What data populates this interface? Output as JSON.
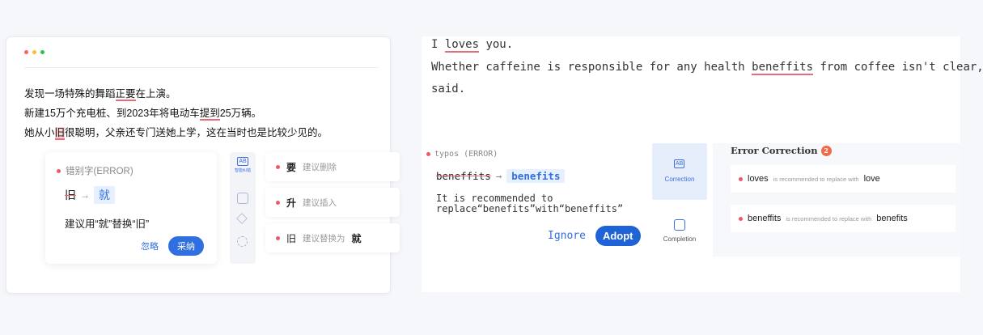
{
  "left": {
    "lines": [
      {
        "a": "发现一场特殊的舞蹈",
        "b": "正要",
        "c": "在上演。"
      },
      {
        "a": "新建15万个充电桩、到2023年将电动车",
        "b": "提到",
        "c": "25万辆。"
      },
      {
        "a": "她从小",
        "b": "旧",
        "c": "很聪明，父亲还专门送她上学，这在当时也是比较少见的。"
      }
    ],
    "error_card": {
      "head": "错别字(ERROR)",
      "wrong": "旧",
      "arrow": "→",
      "right": "就",
      "desc": "建议用“就”替换“旧”",
      "ignore": "忽略",
      "adopt": "采纳"
    },
    "rail_label": "智能纠错",
    "suggestions": [
      {
        "word": "要",
        "hint": "建议删除",
        "extra": ""
      },
      {
        "word": "升",
        "hint": "建议插入",
        "extra": ""
      },
      {
        "word": "旧",
        "hint": "建议替换为",
        "extra": "就"
      }
    ]
  },
  "right": {
    "line1a": "I ",
    "line1b": "loves",
    "line1c": " you.",
    "line2a": "Whether caffeine is responsible for any health ",
    "line2b": "beneffits",
    "line2c": " from coffee isn't clear, Kao",
    "line3": "said.",
    "error_card": {
      "head": "typos (ERROR)",
      "wrong": "beneffits",
      "arrow": "→",
      "right": "benefits",
      "desc1": "It is recommended to",
      "desc2": "replace“benefits”with“beneffits”",
      "ignore": "Ignore",
      "adopt": "Adopt"
    },
    "rail": {
      "correction": "Correction",
      "completion": "Completion"
    },
    "panel": {
      "title": "Error Correction",
      "count": "2",
      "items": [
        {
          "word": "loves",
          "mid": "is recommended to replace with",
          "to": "love"
        },
        {
          "word": "beneffits",
          "mid": "is recommended to replace with",
          "to": "benefits"
        }
      ]
    }
  },
  "colors": {
    "accent": "#2f6fe0",
    "error": "#ea5a6a",
    "dot_red": "#ff6058",
    "dot_yellow": "#ffbd2e",
    "dot_green": "#28c940"
  }
}
